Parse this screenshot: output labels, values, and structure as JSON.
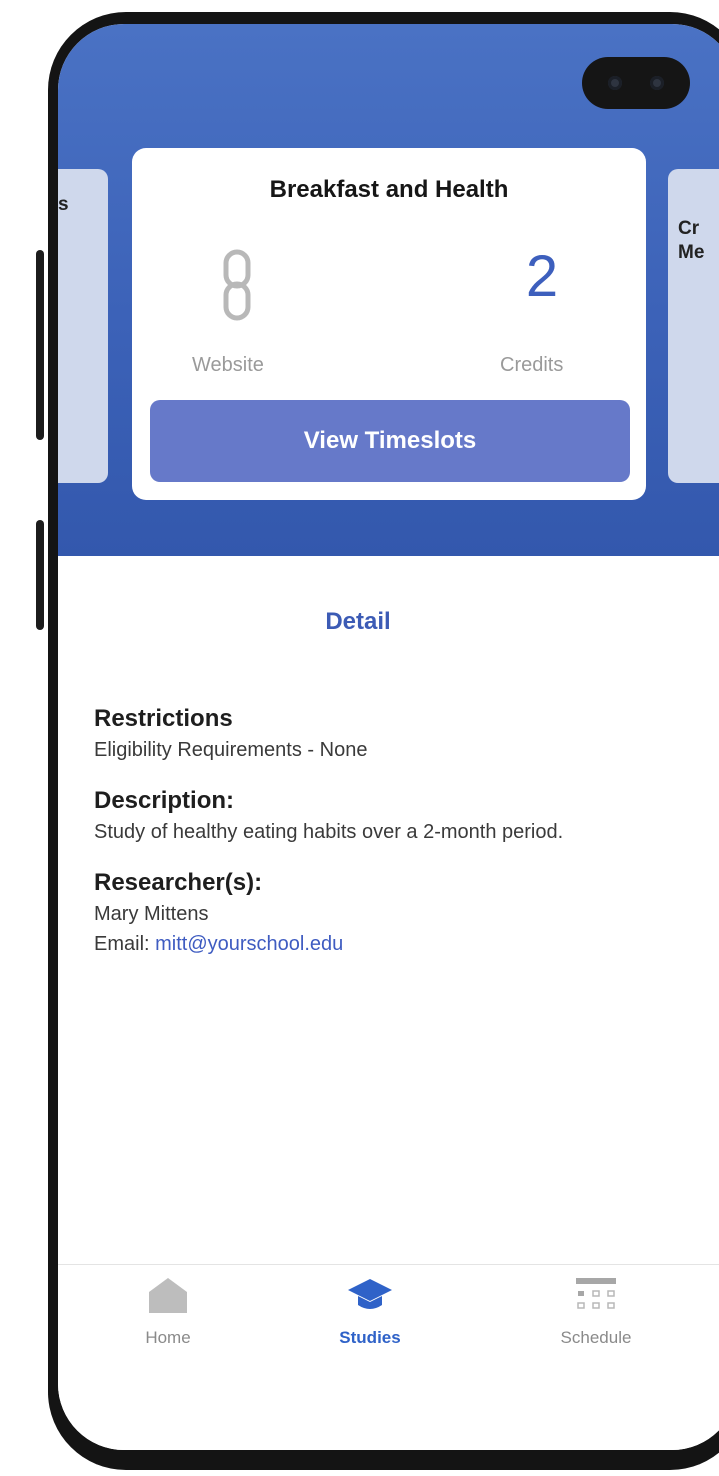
{
  "side_cards": {
    "left_peek": "s",
    "right_peek_line1": "Cr",
    "right_peek_line2": "Me"
  },
  "study": {
    "title": "Breakfast and Health",
    "type_icon": "link-icon",
    "type_label": "Website",
    "credits_value": "2",
    "credits_label": "Credits",
    "view_timeslots_label": "View Timeslots"
  },
  "detail": {
    "heading": "Detail",
    "restrictions_heading": "Restrictions",
    "restrictions_text": "Eligibility Requirements - None",
    "description_heading": "Description:",
    "description_text": "Study of healthy eating habits over a 2-month period.",
    "researchers_heading": "Researcher(s):",
    "researcher_name": "Mary Mittens",
    "email_label": "Email: ",
    "email_value": "mitt@yourschool.edu"
  },
  "tabbar": {
    "items": [
      {
        "label": "Home",
        "icon": "home-icon",
        "active": false
      },
      {
        "label": "Studies",
        "icon": "graduation-cap-icon",
        "active": true
      },
      {
        "label": "Schedule",
        "icon": "calendar-icon",
        "active": false
      }
    ]
  },
  "colors": {
    "header_blue": "#3c62b8",
    "button_blue": "#6679c9",
    "accent_blue": "#3c5bb5",
    "inactive_gray": "#8a8a8a"
  }
}
